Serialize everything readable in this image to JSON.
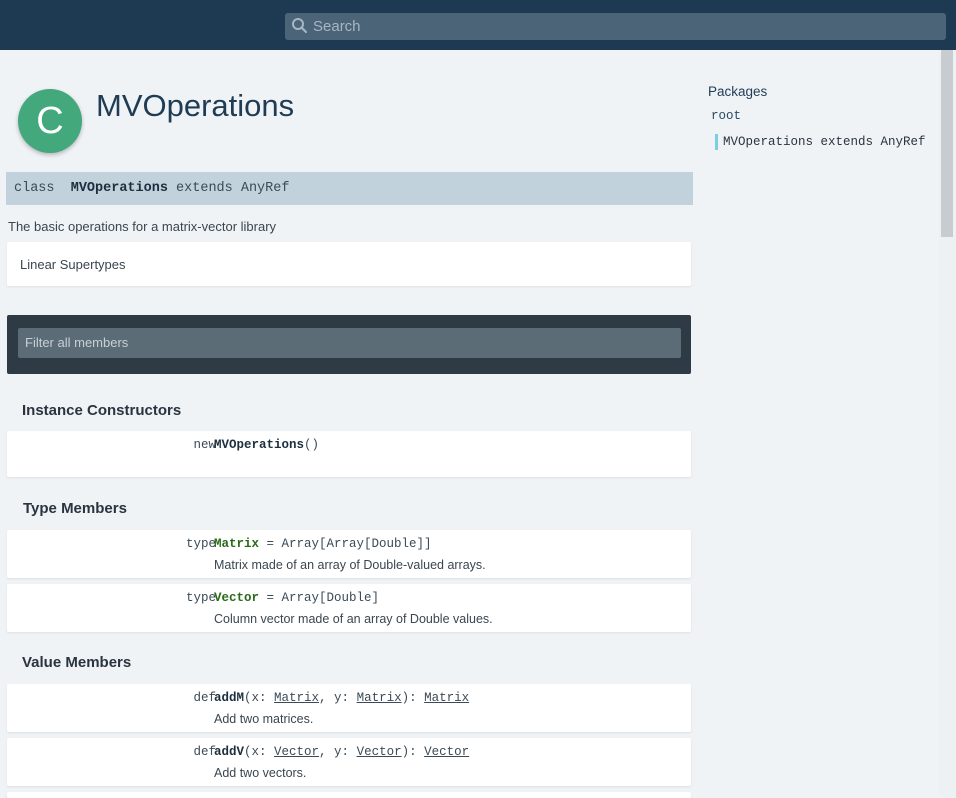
{
  "search": {
    "placeholder": "Search"
  },
  "entity": {
    "badge_letter": "C",
    "name": "MVOperations",
    "signature": {
      "keyword": "class",
      "name": "MVOperations",
      "rest": "extends AnyRef"
    },
    "description": "The basic operations for a matrix-vector library"
  },
  "linear_supertypes": {
    "label": "Linear Supertypes"
  },
  "filter": {
    "placeholder": "Filter all members"
  },
  "sections": {
    "instance_constructors": {
      "title": "Instance Constructors",
      "items": [
        {
          "keyword": "new",
          "name": "MVOperations",
          "params": "()"
        }
      ]
    },
    "type_members": {
      "title": "Type Members",
      "items": [
        {
          "keyword": "type",
          "name": "Matrix",
          "def": " = Array[Array[Double]]",
          "desc": "Matrix made of an array of Double-valued arrays."
        },
        {
          "keyword": "type",
          "name": "Vector",
          "def": " = Array[Double]",
          "desc": "Column vector made of an array of Double values."
        }
      ]
    },
    "value_members": {
      "title": "Value Members",
      "items": [
        {
          "keyword": "def",
          "name": "addM",
          "p1": "(x: ",
          "t1": "Matrix",
          "p2": ", y: ",
          "t2": "Matrix",
          "p3": "): ",
          "ret": "Matrix",
          "desc": "Add two matrices."
        },
        {
          "keyword": "def",
          "name": "addV",
          "p1": "(x: ",
          "t1": "Vector",
          "p2": ", y: ",
          "t2": "Vector",
          "p3": "): ",
          "ret": "Vector",
          "desc": "Add two vectors."
        }
      ]
    }
  },
  "packages": {
    "title": "Packages",
    "root": "root",
    "current": "MVOperations extends AnyRef"
  },
  "colors": {
    "topbar": "#1d3a52",
    "badge": "#43a87c",
    "signature_bar": "#c2d2dc",
    "type_name": "#2a6b1a",
    "package_marker": "#7ccfe0"
  },
  "icons": {
    "search": "search-icon"
  }
}
